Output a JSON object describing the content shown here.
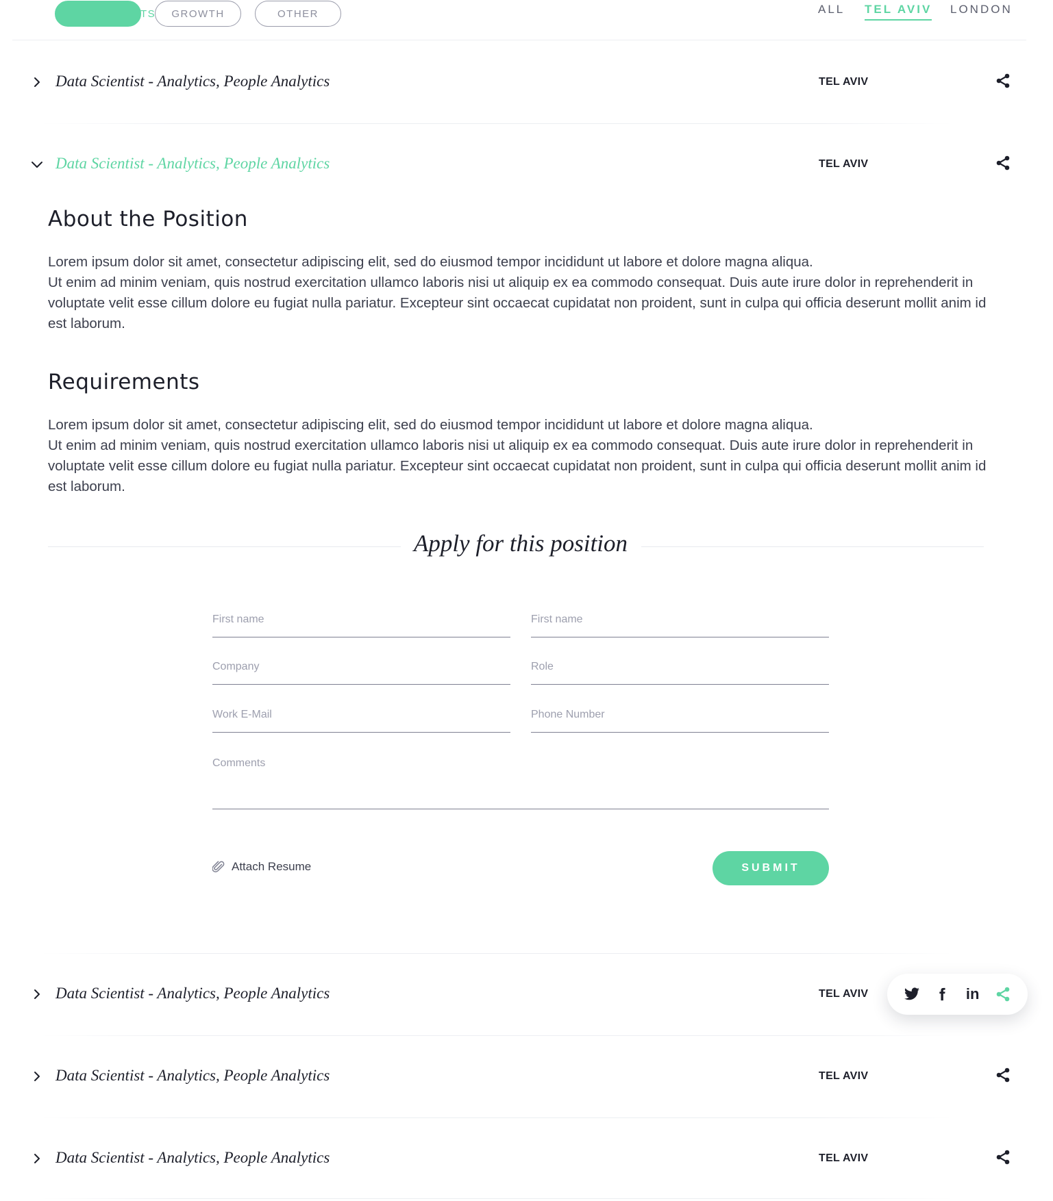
{
  "filters": {
    "active_partial_text": "TS",
    "growth_label": "GROWTH",
    "other_label": "OTHER"
  },
  "locations": {
    "all_label": "ALL",
    "tel_aviv_label": "TEL AVIV",
    "london_label": "LONDON",
    "selected": "TEL AVIV"
  },
  "jobs": [
    {
      "title": "Data Scientist - Analytics, People Analytics",
      "location": "TEL AVIV",
      "expanded": false
    },
    {
      "title": "Data Scientist - Analytics, People Analytics",
      "location": "TEL AVIV",
      "expanded": true
    },
    {
      "title": "Data Scientist - Analytics, People Analytics",
      "location": "TEL AVIV",
      "expanded": false,
      "share_open": true
    },
    {
      "title": "Data Scientist - Analytics, People Analytics",
      "location": "TEL AVIV",
      "expanded": false
    },
    {
      "title": "Data Scientist - Analytics, People Analytics",
      "location": "TEL AVIV",
      "expanded": false
    }
  ],
  "details": {
    "about_heading": "About the Position",
    "about_line1": "Lorem ipsum dolor sit amet, consectetur adipiscing elit, sed do eiusmod tempor incididunt ut labore et dolore magna aliqua.",
    "about_line2": "Ut enim ad minim veniam, quis nostrud exercitation ullamco laboris nisi ut aliquip ex ea commodo consequat. Duis aute irure dolor in reprehenderit in voluptate velit esse cillum dolore eu fugiat nulla pariatur. Excepteur sint occaecat cupidatat non proident, sunt in culpa qui officia deserunt mollit anim id est laborum.",
    "req_heading": "Requirements",
    "req_line1": "Lorem ipsum dolor sit amet, consectetur adipiscing elit, sed do eiusmod tempor incididunt ut labore et dolore magna aliqua.",
    "req_line2": "Ut enim ad minim veniam, quis nostrud exercitation ullamco laboris nisi ut aliquip ex ea commodo consequat. Duis aute irure dolor in reprehenderit in voluptate velit esse cillum dolore eu fugiat nulla pariatur. Excepteur sint occaecat cupidatat non proident, sunt in culpa qui officia deserunt mollit anim id est laborum."
  },
  "form": {
    "title": "Apply for this position",
    "first_name_placeholder": "First name",
    "second_name_placeholder": "First name",
    "company_placeholder": "Company",
    "role_placeholder": "Role",
    "email_placeholder": "Work E-Mail",
    "phone_placeholder": "Phone Number",
    "comments_placeholder": "Comments",
    "attach_label": "Attach Resume",
    "submit_label": "SUBMIT"
  },
  "share_popover": {
    "items": [
      "twitter-icon",
      "facebook-icon",
      "linkedin-icon",
      "share-icon"
    ],
    "linkedin_text": "in"
  },
  "colors": {
    "accent": "#5ed5a3",
    "text_dark": "#1d1f2a",
    "text_body": "#3c3f4d",
    "muted": "#9d9fae",
    "divider": "#eceef2"
  }
}
